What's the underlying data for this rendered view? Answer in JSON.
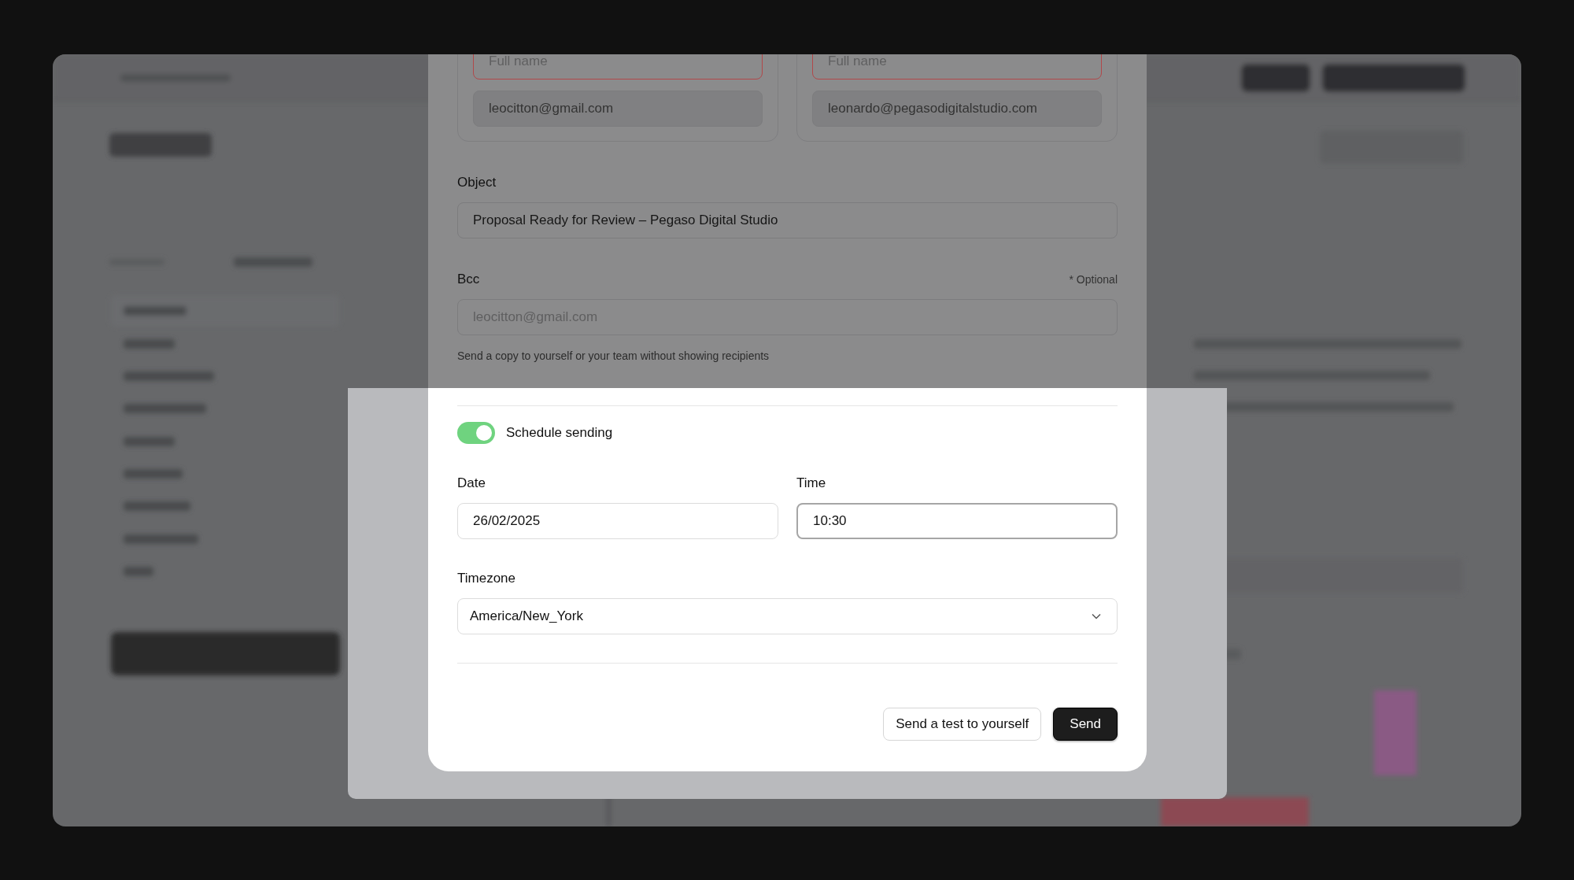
{
  "email_dialog": {
    "recipients": [
      {
        "name_placeholder": "Full name",
        "invalid": true,
        "email": "leocitton@gmail.com"
      },
      {
        "name_placeholder": "Full name",
        "invalid": true,
        "email": "leonardo@pegasodigitalstudio.com"
      }
    ],
    "object": {
      "label": "Object",
      "value": "Proposal Ready for Review – Pegaso Digital Studio"
    },
    "bcc": {
      "label": "Bcc",
      "note": "* Optional",
      "placeholder": "leocitton@gmail.com",
      "hint": "Send a copy to yourself or your team without showing recipients"
    },
    "schedule": {
      "label": "Schedule sending",
      "on": true
    },
    "date": {
      "label": "Date",
      "value": "26/02/2025",
      "focused": false
    },
    "time": {
      "label": "Time",
      "value": "10:30",
      "focused": true
    },
    "timezone": {
      "label": "Timezone",
      "value": "America/New_York"
    },
    "buttons": [
      {
        "label": "Send a test to yourself",
        "kind": "secondary"
      },
      {
        "label": "Send",
        "kind": "primary"
      }
    ]
  }
}
